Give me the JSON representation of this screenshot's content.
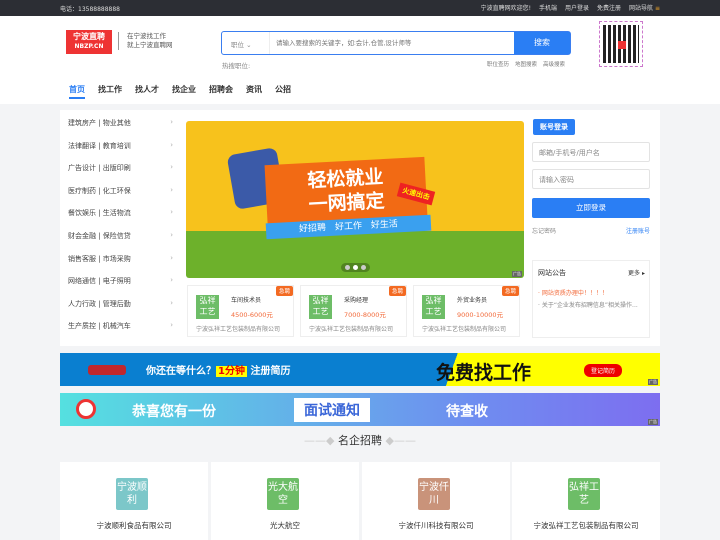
{
  "topbar": {
    "phone": "电话：13588888888",
    "welcome": "宁波直聘网欢迎您!",
    "mobile": "手机端",
    "login": "用户登录",
    "register": "免费注册",
    "sitenav": "网站导航"
  },
  "header": {
    "logo_cn": "宁波直聘",
    "logo_en": "NBZP.CN",
    "slogan1": "在宁波找工作",
    "slogan2": "就上宁波直聘网",
    "search_category": "职位",
    "search_placeholder": "请输入要搜索的关键字，如:会计,仓管,设计师等",
    "search_button": "搜索",
    "hot_label": "热搜职位:",
    "links": [
      "职位查历",
      "地图搜索",
      "高级搜索"
    ]
  },
  "nav": [
    "首页",
    "找工作",
    "找人才",
    "找企业",
    "招聘会",
    "资讯",
    "公招"
  ],
  "categories": [
    "建筑房产 | 物业其他",
    "法律翻译 | 教育培训",
    "广告设计 | 出版印刷",
    "医疗制药 | 化工环保",
    "餐饮娱乐 | 生活物流",
    "财会金融 | 保险信贷",
    "销售客服 | 市场采购",
    "网络通信 | 电子照明",
    "人力行政 | 管理后勤",
    "生产质控 | 机械汽车"
  ],
  "banner": {
    "line1": "轻松就业",
    "line2": "一网搞定",
    "sub": "好招聘　好工作　好生活",
    "flag": "火速出击",
    "ad": "广告"
  },
  "jobs": [
    {
      "logo": "弘祥工艺",
      "title": "车间技术员",
      "salary": "4500-6000元",
      "company": "宁波弘祥工艺包装制品有限公司",
      "badge": "急聘"
    },
    {
      "logo": "弘祥工艺",
      "title": "采购经理",
      "salary": "7000-8000元",
      "company": "宁波弘祥工艺包装制品有限公司",
      "badge": "急聘"
    },
    {
      "logo": "弘祥工艺",
      "title": "外贸业务员",
      "salary": "9000-10000元",
      "company": "宁波弘祥工艺包装制品有限公司",
      "badge": "急聘"
    }
  ],
  "login": {
    "tab": "账号登录",
    "user_placeholder": "邮箱/手机号/用户名",
    "pass_placeholder": "请输入密码",
    "button": "立即登录",
    "forgot": "忘记密码",
    "register": "注册账号"
  },
  "notice": {
    "title": "网站公告",
    "more": "更多",
    "items": [
      "网站资质办理中！！！！",
      "关于“企业发布招聘信息”相关操作..."
    ]
  },
  "ads": {
    "bar1_text": "你还在等什么？",
    "bar1_hl": "1分钟",
    "bar1_text2": "注册简历",
    "bar1_big": "免费找工作",
    "bar1_btn": "登记简历",
    "bar2_a": "恭喜您有一份",
    "bar2_b": "面试通知",
    "bar2_c": "待查收",
    "ad": "广告"
  },
  "section_title": "名企招聘",
  "companies": [
    {
      "logo": "宁波顺利",
      "name": "宁波顺利食品有限公司",
      "color": "#7cc7c9"
    },
    {
      "logo": "光大航空",
      "name": "光大航空",
      "color": "#6dbd67"
    },
    {
      "logo": "宁波仟川",
      "name": "宁波仟川科技有限公司",
      "color": "#c9937a"
    },
    {
      "logo": "弘祥工艺",
      "name": "宁波弘祥工艺包装制品有限公司",
      "color": "#6dbd67"
    }
  ]
}
